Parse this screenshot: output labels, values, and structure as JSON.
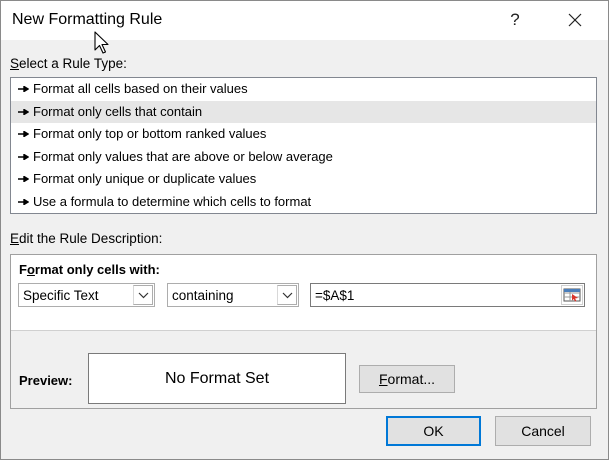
{
  "dialog": {
    "title": "New Formatting Rule",
    "help_label": "?"
  },
  "rule_type": {
    "label_accel": "S",
    "label_rest": "elect a Rule Type:",
    "items": [
      {
        "label": "Format all cells based on their values"
      },
      {
        "label": "Format only cells that contain",
        "selected": true
      },
      {
        "label": "Format only top or bottom ranked values"
      },
      {
        "label": "Format only values that are above or below average"
      },
      {
        "label": "Format only unique or duplicate values"
      },
      {
        "label": "Use a formula to determine which cells to format"
      }
    ]
  },
  "description": {
    "label_accel": "E",
    "label_rest": "dit the Rule Description:",
    "heading_pre": "F",
    "heading_accel": "o",
    "heading_rest": "rmat only cells with:",
    "condition_type": "Specific Text",
    "operator": "containing",
    "reference": "=$A$1",
    "preview_label": "Preview:",
    "preview_text": "No Format Set",
    "format_accel": "F",
    "format_rest": "ormat..."
  },
  "buttons": {
    "ok": "OK",
    "cancel": "Cancel"
  },
  "colors": {
    "selected_row": "#e6e6e6",
    "default_button_border": "#0078d7",
    "dialog_bg": "#f0f0f0"
  }
}
